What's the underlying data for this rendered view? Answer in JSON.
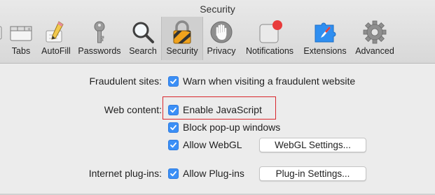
{
  "window": {
    "title": "Security"
  },
  "toolbar": {
    "items": [
      {
        "label": "",
        "icon": "general-icon"
      },
      {
        "label": "Tabs",
        "icon": "tabs-icon"
      },
      {
        "label": "AutoFill",
        "icon": "autofill-pencil-icon"
      },
      {
        "label": "Passwords",
        "icon": "key-icon"
      },
      {
        "label": "Search",
        "icon": "magnifier-icon"
      },
      {
        "label": "Security",
        "icon": "lock-icon",
        "selected": true
      },
      {
        "label": "Privacy",
        "icon": "hand-icon"
      },
      {
        "label": "Notifications",
        "icon": "notification-badge-icon"
      },
      {
        "label": "Extensions",
        "icon": "puzzle-compass-icon"
      },
      {
        "label": "Advanced",
        "icon": "gear-icon"
      }
    ]
  },
  "fraudulent": {
    "label": "Fraudulent sites:",
    "warn": {
      "text": "Warn when visiting a fraudulent website",
      "checked": true
    }
  },
  "web_content": {
    "label": "Web content:",
    "javascript": {
      "text": "Enable JavaScript",
      "checked": true
    },
    "popups": {
      "text": "Block pop-up windows",
      "checked": true
    },
    "webgl": {
      "text": "Allow WebGL",
      "checked": true,
      "button": "WebGL Settings..."
    }
  },
  "plugins": {
    "label": "Internet plug-ins:",
    "allow": {
      "text": "Allow Plug-ins",
      "checked": true,
      "button": "Plug-in Settings..."
    }
  },
  "colors": {
    "checkbox": "#3b8ff6",
    "highlight": "#d9262c",
    "notification_dot": "#e83b3b"
  }
}
